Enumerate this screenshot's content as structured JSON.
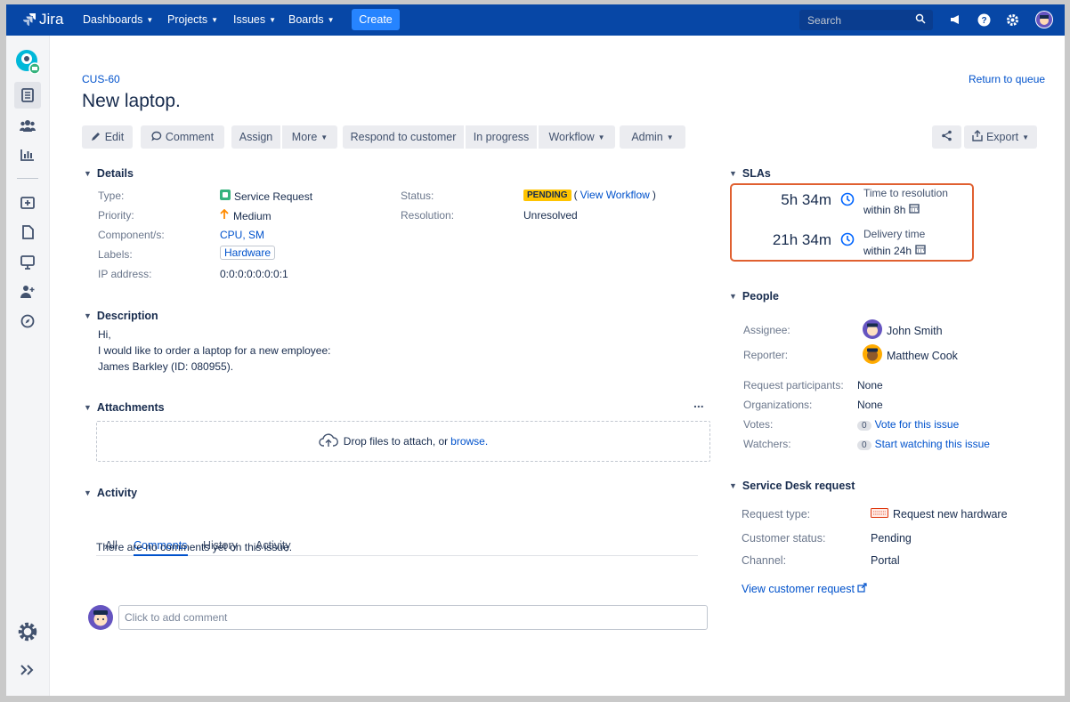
{
  "topnav": {
    "logo": "Jira",
    "items": [
      "Dashboards",
      "Projects",
      "Issues",
      "Boards"
    ],
    "create_label": "Create",
    "search_placeholder": "Search"
  },
  "issue": {
    "key": "CUS-60",
    "title": "New laptop.",
    "return_link": "Return to queue"
  },
  "toolbar": {
    "edit": "Edit",
    "comment": "Comment",
    "assign": "Assign",
    "more": "More",
    "respond": "Respond to customer",
    "in_progress": "In progress",
    "workflow": "Workflow",
    "admin": "Admin",
    "export": "Export"
  },
  "details": {
    "heading": "Details",
    "type_label": "Type:",
    "type_value": "Service Request",
    "priority_label": "Priority:",
    "priority_value": "Medium",
    "component_label": "Component/s:",
    "component_value": "CPU, SM",
    "labels_label": "Labels:",
    "labels_value": "Hardware",
    "ip_label": "IP address:",
    "ip_value": "0:0:0:0:0:0:0:1",
    "status_label": "Status:",
    "status_value": "PENDING",
    "view_workflow": "View Workflow",
    "resolution_label": "Resolution:",
    "resolution_value": "Unresolved"
  },
  "description": {
    "heading": "Description",
    "line1": "Hi,",
    "line2": "I would like to order a laptop for a new employee:",
    "line3": "James Barkley (ID: 080955)."
  },
  "attachments": {
    "heading": "Attachments",
    "more": "...",
    "drop_text": "Drop files to attach, or",
    "browse": "browse."
  },
  "activity": {
    "heading": "Activity",
    "tabs": [
      "All",
      "Comments",
      "History",
      "Activity"
    ],
    "empty": "There are no comments yet on this issue.",
    "comment_placeholder": "Click to add comment"
  },
  "slas": {
    "heading": "SLAs",
    "items": [
      {
        "time": "5h 34m",
        "name": "Time to resolution",
        "goal": "within 8h"
      },
      {
        "time": "21h 34m",
        "name": "Delivery time",
        "goal": "within 24h"
      }
    ]
  },
  "people": {
    "heading": "People",
    "assignee_label": "Assignee:",
    "assignee": "John Smith",
    "reporter_label": "Reporter:",
    "reporter": "Matthew Cook",
    "participants_label": "Request participants:",
    "participants": "None",
    "organizations_label": "Organizations:",
    "organizations": "None",
    "votes_label": "Votes:",
    "votes_count": "0",
    "votes_link": "Vote for this issue",
    "watchers_label": "Watchers:",
    "watchers_count": "0",
    "watchers_link": "Start watching this issue"
  },
  "sd_request": {
    "heading": "Service Desk request",
    "type_label": "Request type:",
    "type_value": "Request new hardware",
    "status_label": "Customer status:",
    "status_value": "Pending",
    "channel_label": "Channel:",
    "channel_value": "Portal",
    "view_link": "View customer request"
  },
  "colors": {
    "nav_bg": "#0747a6",
    "accent": "#0052cc",
    "pending": "#ffc400",
    "sla_border": "#e06030"
  }
}
